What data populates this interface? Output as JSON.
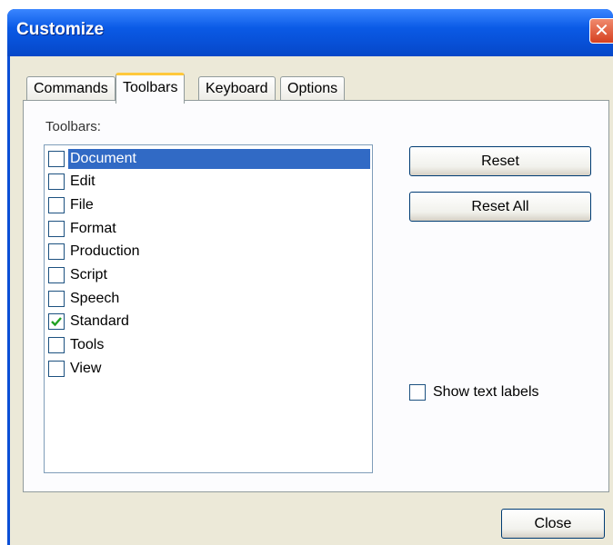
{
  "window": {
    "title": "Customize",
    "close_glyph": "✕"
  },
  "tabs": [
    {
      "label": "Commands",
      "active": false
    },
    {
      "label": "Toolbars",
      "active": true
    },
    {
      "label": "Keyboard",
      "active": false
    },
    {
      "label": "Options",
      "active": false
    }
  ],
  "toolbars_panel": {
    "section_label": "Toolbars:",
    "items": [
      {
        "label": "Document",
        "checked": false,
        "selected": true
      },
      {
        "label": "Edit",
        "checked": false,
        "selected": false
      },
      {
        "label": "File",
        "checked": false,
        "selected": false
      },
      {
        "label": "Format",
        "checked": false,
        "selected": false
      },
      {
        "label": "Production",
        "checked": false,
        "selected": false
      },
      {
        "label": "Script",
        "checked": false,
        "selected": false
      },
      {
        "label": "Speech",
        "checked": false,
        "selected": false
      },
      {
        "label": "Standard",
        "checked": true,
        "selected": false
      },
      {
        "label": "Tools",
        "checked": false,
        "selected": false
      },
      {
        "label": "View",
        "checked": false,
        "selected": false
      }
    ],
    "reset_label": "Reset",
    "reset_all_label": "Reset All",
    "show_text_labels": {
      "label": "Show text labels",
      "checked": false
    }
  },
  "footer": {
    "close_label": "Close"
  },
  "colors": {
    "title_bar": "#0a5ae6",
    "selection": "#316ac5",
    "active_tab_highlight": "#ffc83c",
    "check_mark": "#21a121"
  },
  "icons": {
    "check": "check-icon",
    "close": "close-icon"
  }
}
